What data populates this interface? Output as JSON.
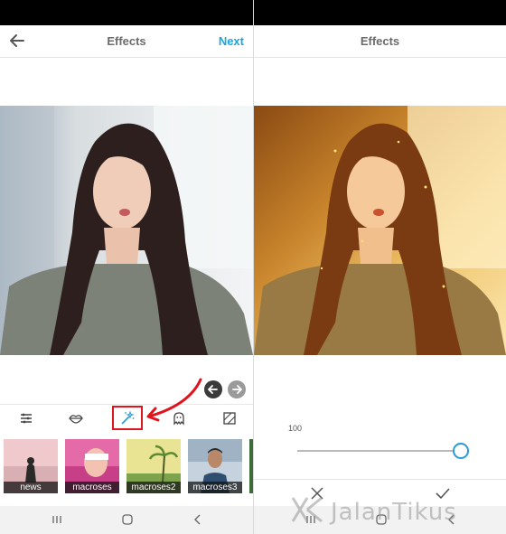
{
  "left_screen": {
    "appbar": {
      "title": "Effects",
      "next_label": "Next"
    },
    "toolbar": {
      "tools": [
        "adjust-icon",
        "lips-icon",
        "magic-wand-icon",
        "ghost-icon",
        "grid-icon"
      ],
      "selected": "magic-wand-icon"
    },
    "filters": [
      {
        "label": "news",
        "colors": [
          "#c9a8a8",
          "#f2c5c5"
        ]
      },
      {
        "label": "macroses",
        "colors": [
          "#d2478b",
          "#f5a8c8"
        ]
      },
      {
        "label": "macroses2",
        "colors": [
          "#8ab24a",
          "#e6e28a"
        ]
      },
      {
        "label": "macroses3",
        "colors": [
          "#5d7fa3",
          "#c8d6e2"
        ]
      }
    ]
  },
  "right_screen": {
    "appbar": {
      "title": "Effects"
    },
    "slider": {
      "value_label": "100",
      "value": 100
    }
  },
  "watermark": {
    "text": "JalanTikus"
  },
  "colors": {
    "accent": "#18a6e0",
    "highlight": "#e0141d"
  }
}
